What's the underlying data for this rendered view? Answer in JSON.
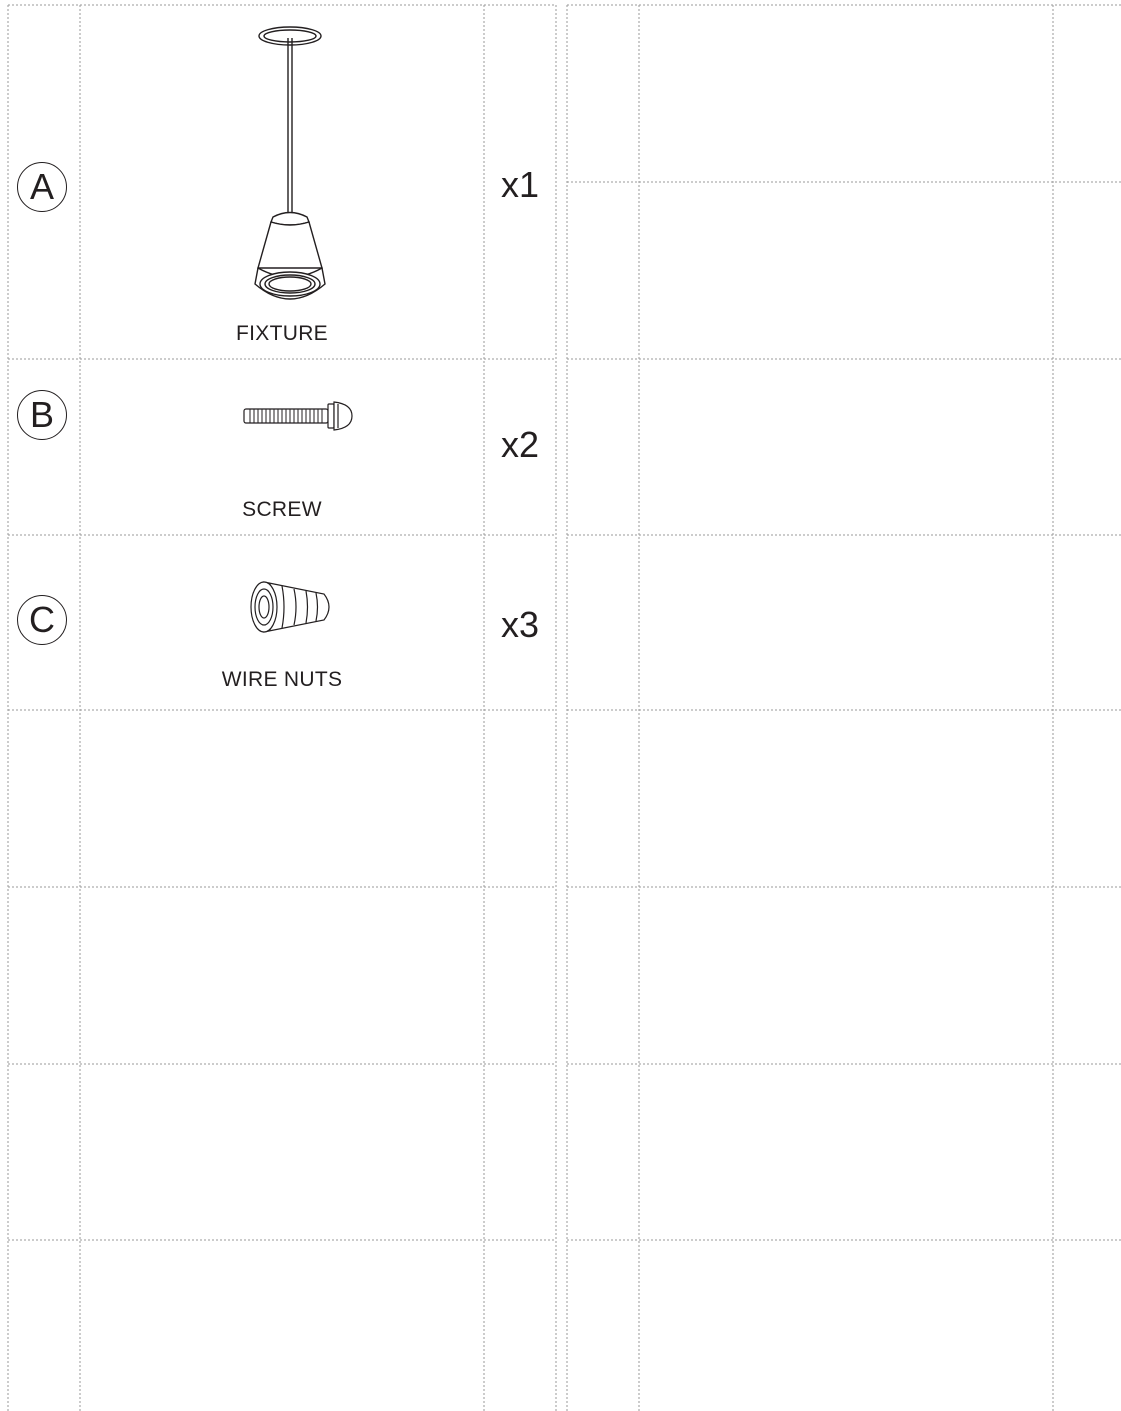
{
  "parts": [
    {
      "letter": "A",
      "name": "FIXTURE",
      "qty": "x1",
      "icon": "pendant-fixture-icon"
    },
    {
      "letter": "B",
      "name": "SCREW",
      "qty": "x2",
      "icon": "screw-icon"
    },
    {
      "letter": "C",
      "name": "WIRE NUTS",
      "qty": "x3",
      "icon": "wire-nut-icon"
    }
  ],
  "line_color": "#9a9a9a",
  "ink_color": "#231f20"
}
